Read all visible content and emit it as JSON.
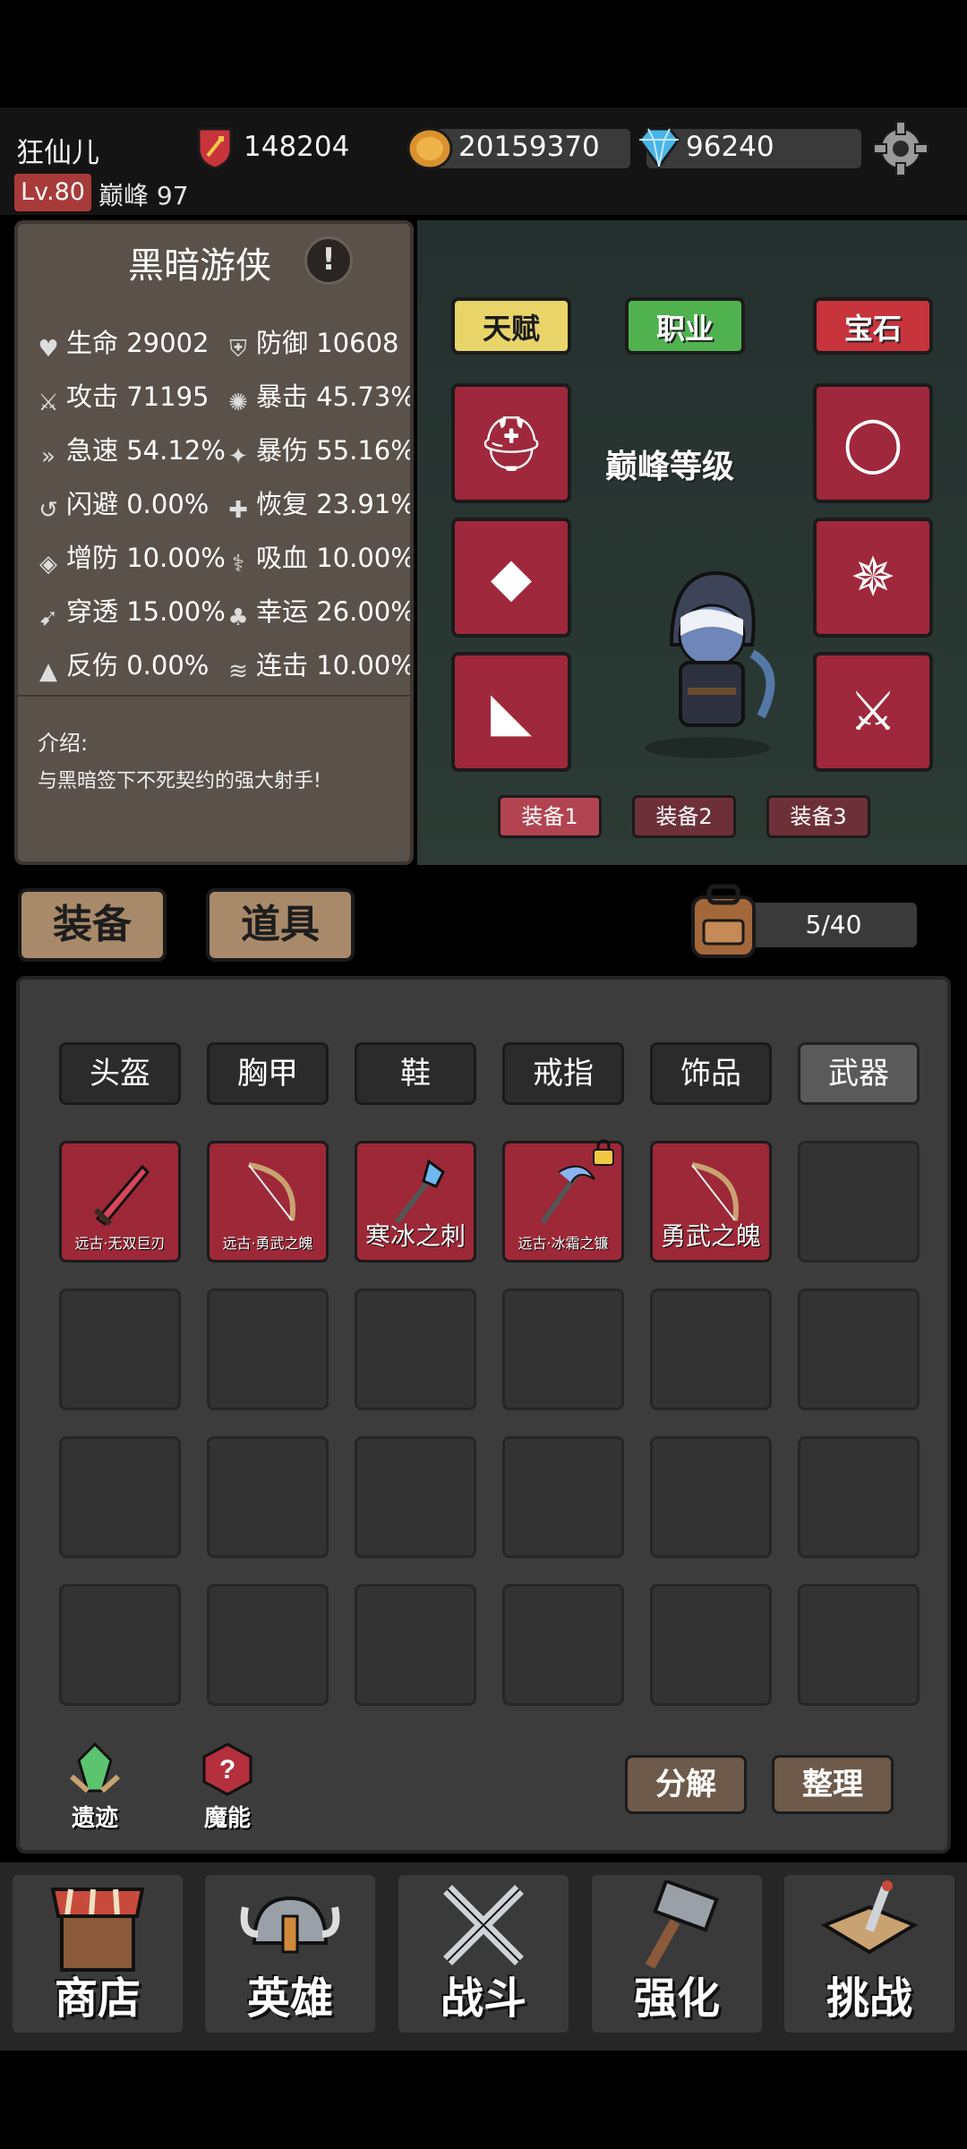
{
  "player": {
    "name": "狂仙儿",
    "level": "Lv.80",
    "peak": "巅峰 97",
    "power": "148204"
  },
  "currency": {
    "gold": "20159370",
    "diamonds": "96240"
  },
  "hero": {
    "name": "黑暗游侠",
    "stats": [
      {
        "label": "生命",
        "value": "29002"
      },
      {
        "label": "防御",
        "value": "10608"
      },
      {
        "label": "攻击",
        "value": "71195"
      },
      {
        "label": "暴击",
        "value": "45.73%"
      },
      {
        "label": "急速",
        "value": "54.12%"
      },
      {
        "label": "暴伤",
        "value": "55.16%"
      },
      {
        "label": "闪避",
        "value": "0.00%"
      },
      {
        "label": "恢复",
        "value": "23.91%"
      },
      {
        "label": "增防",
        "value": "10.00%"
      },
      {
        "label": "吸血",
        "value": "10.00%"
      },
      {
        "label": "穿透",
        "value": "15.00%"
      },
      {
        "label": "幸运",
        "value": "26.00%"
      },
      {
        "label": "反伤",
        "value": "0.00%"
      },
      {
        "label": "连击",
        "value": "10.00%"
      }
    ],
    "intro_label": "介绍:",
    "intro_text": "与黑暗签下不死契约的强大射手!"
  },
  "hero_menu": {
    "talent": "天赋",
    "class": "职业",
    "gem": "宝石",
    "peak_level": "巅峰等级"
  },
  "loadouts": [
    "装备1",
    "装备2",
    "装备3"
  ],
  "bag": {
    "tabs": {
      "equip": "装备",
      "items": "道具"
    },
    "count": "5/40",
    "filters": [
      "头盔",
      "胸甲",
      "鞋",
      "戒指",
      "饰品",
      "武器"
    ],
    "items": [
      {
        "name": "远古·无双巨刃"
      },
      {
        "name": "远古·勇武之魄"
      },
      {
        "name": "寒冰之刺"
      },
      {
        "name": "远古·冰霜之镰"
      },
      {
        "name": "勇武之魄"
      }
    ],
    "relic": "遗迹",
    "magic": "魔能",
    "decompose": "分解",
    "sort": "整理"
  },
  "nav": [
    "商店",
    "英雄",
    "战斗",
    "强化",
    "挑战"
  ],
  "colors": {
    "accent_red": "#a0283c",
    "panel": "#5a524a",
    "talent": "#e9d46a",
    "class": "#4fb24f",
    "gem": "#c8343c"
  }
}
